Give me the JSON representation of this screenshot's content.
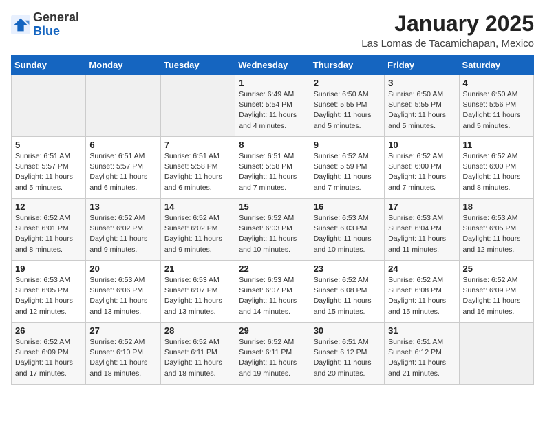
{
  "logo": {
    "general": "General",
    "blue": "Blue",
    "icon_title": "GeneralBlue logo"
  },
  "title": "January 2025",
  "subtitle": "Las Lomas de Tacamichapan, Mexico",
  "days_of_week": [
    "Sunday",
    "Monday",
    "Tuesday",
    "Wednesday",
    "Thursday",
    "Friday",
    "Saturday"
  ],
  "weeks": [
    [
      {
        "num": "",
        "info": ""
      },
      {
        "num": "",
        "info": ""
      },
      {
        "num": "",
        "info": ""
      },
      {
        "num": "1",
        "info": "Sunrise: 6:49 AM\nSunset: 5:54 PM\nDaylight: 11 hours\nand 4 minutes."
      },
      {
        "num": "2",
        "info": "Sunrise: 6:50 AM\nSunset: 5:55 PM\nDaylight: 11 hours\nand 5 minutes."
      },
      {
        "num": "3",
        "info": "Sunrise: 6:50 AM\nSunset: 5:55 PM\nDaylight: 11 hours\nand 5 minutes."
      },
      {
        "num": "4",
        "info": "Sunrise: 6:50 AM\nSunset: 5:56 PM\nDaylight: 11 hours\nand 5 minutes."
      }
    ],
    [
      {
        "num": "5",
        "info": "Sunrise: 6:51 AM\nSunset: 5:57 PM\nDaylight: 11 hours\nand 5 minutes."
      },
      {
        "num": "6",
        "info": "Sunrise: 6:51 AM\nSunset: 5:57 PM\nDaylight: 11 hours\nand 6 minutes."
      },
      {
        "num": "7",
        "info": "Sunrise: 6:51 AM\nSunset: 5:58 PM\nDaylight: 11 hours\nand 6 minutes."
      },
      {
        "num": "8",
        "info": "Sunrise: 6:51 AM\nSunset: 5:58 PM\nDaylight: 11 hours\nand 7 minutes."
      },
      {
        "num": "9",
        "info": "Sunrise: 6:52 AM\nSunset: 5:59 PM\nDaylight: 11 hours\nand 7 minutes."
      },
      {
        "num": "10",
        "info": "Sunrise: 6:52 AM\nSunset: 6:00 PM\nDaylight: 11 hours\nand 7 minutes."
      },
      {
        "num": "11",
        "info": "Sunrise: 6:52 AM\nSunset: 6:00 PM\nDaylight: 11 hours\nand 8 minutes."
      }
    ],
    [
      {
        "num": "12",
        "info": "Sunrise: 6:52 AM\nSunset: 6:01 PM\nDaylight: 11 hours\nand 8 minutes."
      },
      {
        "num": "13",
        "info": "Sunrise: 6:52 AM\nSunset: 6:02 PM\nDaylight: 11 hours\nand 9 minutes."
      },
      {
        "num": "14",
        "info": "Sunrise: 6:52 AM\nSunset: 6:02 PM\nDaylight: 11 hours\nand 9 minutes."
      },
      {
        "num": "15",
        "info": "Sunrise: 6:52 AM\nSunset: 6:03 PM\nDaylight: 11 hours\nand 10 minutes."
      },
      {
        "num": "16",
        "info": "Sunrise: 6:53 AM\nSunset: 6:03 PM\nDaylight: 11 hours\nand 10 minutes."
      },
      {
        "num": "17",
        "info": "Sunrise: 6:53 AM\nSunset: 6:04 PM\nDaylight: 11 hours\nand 11 minutes."
      },
      {
        "num": "18",
        "info": "Sunrise: 6:53 AM\nSunset: 6:05 PM\nDaylight: 11 hours\nand 12 minutes."
      }
    ],
    [
      {
        "num": "19",
        "info": "Sunrise: 6:53 AM\nSunset: 6:05 PM\nDaylight: 11 hours\nand 12 minutes."
      },
      {
        "num": "20",
        "info": "Sunrise: 6:53 AM\nSunset: 6:06 PM\nDaylight: 11 hours\nand 13 minutes."
      },
      {
        "num": "21",
        "info": "Sunrise: 6:53 AM\nSunset: 6:07 PM\nDaylight: 11 hours\nand 13 minutes."
      },
      {
        "num": "22",
        "info": "Sunrise: 6:53 AM\nSunset: 6:07 PM\nDaylight: 11 hours\nand 14 minutes."
      },
      {
        "num": "23",
        "info": "Sunrise: 6:52 AM\nSunset: 6:08 PM\nDaylight: 11 hours\nand 15 minutes."
      },
      {
        "num": "24",
        "info": "Sunrise: 6:52 AM\nSunset: 6:08 PM\nDaylight: 11 hours\nand 15 minutes."
      },
      {
        "num": "25",
        "info": "Sunrise: 6:52 AM\nSunset: 6:09 PM\nDaylight: 11 hours\nand 16 minutes."
      }
    ],
    [
      {
        "num": "26",
        "info": "Sunrise: 6:52 AM\nSunset: 6:09 PM\nDaylight: 11 hours\nand 17 minutes."
      },
      {
        "num": "27",
        "info": "Sunrise: 6:52 AM\nSunset: 6:10 PM\nDaylight: 11 hours\nand 18 minutes."
      },
      {
        "num": "28",
        "info": "Sunrise: 6:52 AM\nSunset: 6:11 PM\nDaylight: 11 hours\nand 18 minutes."
      },
      {
        "num": "29",
        "info": "Sunrise: 6:52 AM\nSunset: 6:11 PM\nDaylight: 11 hours\nand 19 minutes."
      },
      {
        "num": "30",
        "info": "Sunrise: 6:51 AM\nSunset: 6:12 PM\nDaylight: 11 hours\nand 20 minutes."
      },
      {
        "num": "31",
        "info": "Sunrise: 6:51 AM\nSunset: 6:12 PM\nDaylight: 11 hours\nand 21 minutes."
      },
      {
        "num": "",
        "info": ""
      }
    ]
  ]
}
